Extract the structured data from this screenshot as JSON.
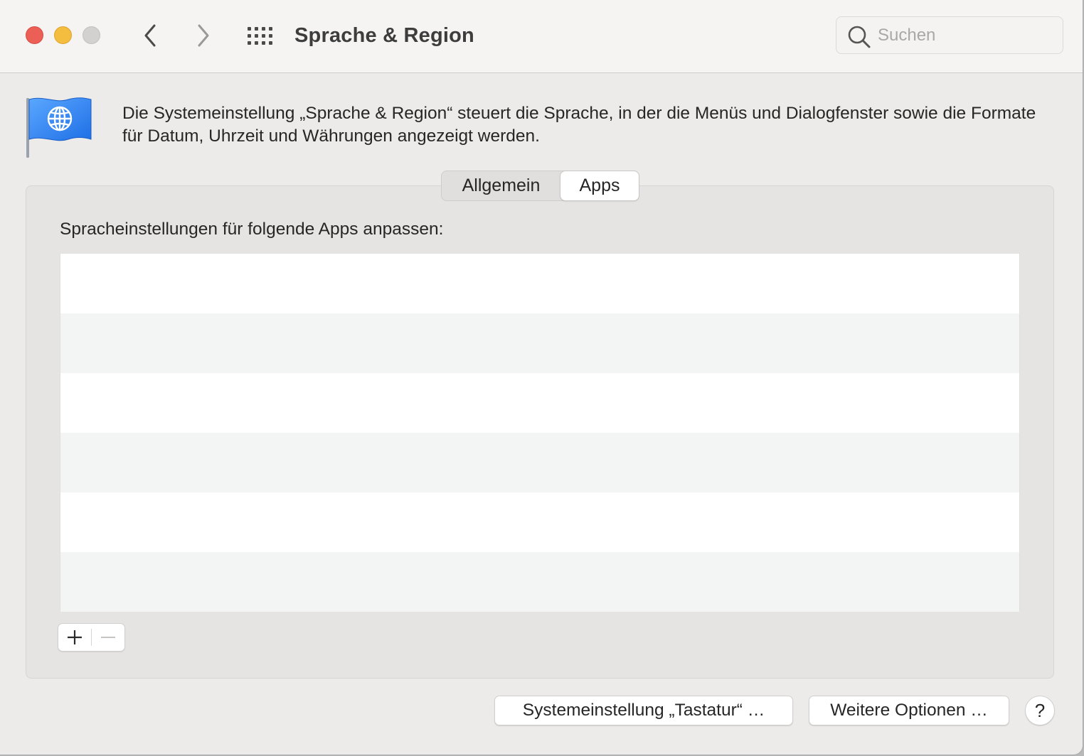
{
  "window": {
    "title": "Sprache & Region"
  },
  "toolbar": {
    "back_icon": "chevron-left-icon",
    "forward_icon": "chevron-right-icon",
    "show_all_icon": "grid-icon"
  },
  "search": {
    "placeholder": "Suchen",
    "value": ""
  },
  "header": {
    "icon": "flag-globe-icon",
    "description": "Die Systemeinstellung „Sprache & Region“ steuert die Sprache, in der die Menüs und Dialogfenster sowie die Formate für Datum, Uhrzeit und Währungen angezeigt werden."
  },
  "tabs": [
    {
      "label": "Allgemein",
      "selected": false
    },
    {
      "label": "Apps",
      "selected": true
    }
  ],
  "apps_panel": {
    "heading": "Spracheinstellungen für folgende Apps anpassen:",
    "items": [],
    "add_icon": "plus-icon",
    "remove_icon": "minus-icon",
    "remove_enabled": false
  },
  "footer": {
    "keyboard_button": "Systemeinstellung „Tastatur“ …",
    "options_button": "Weitere Optionen …",
    "help_button": "?"
  },
  "colors": {
    "close": "#ec5f57",
    "minimize": "#f4bd3f",
    "zoom_inactive": "#d3d1d0",
    "flag_blue": "#2f7ff0"
  }
}
